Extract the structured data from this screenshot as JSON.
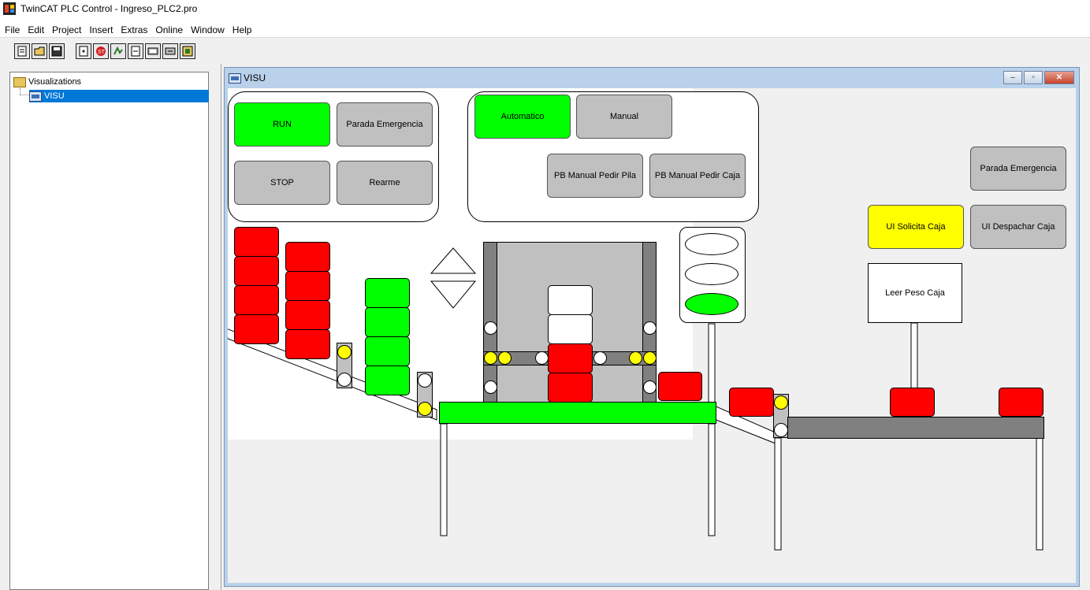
{
  "app": {
    "title": "TwinCAT PLC Control - Ingreso_PLC2.pro"
  },
  "menu": [
    "File",
    "Edit",
    "Project",
    "Insert",
    "Extras",
    "Online",
    "Window",
    "Help"
  ],
  "toolbar_icons": [
    "new-file-icon",
    "open-folder-icon",
    "save-icon",
    "login-icon",
    "stop-icon",
    "run-icon",
    "step-icon",
    "download-icon",
    "upload-icon",
    "monitor-icon"
  ],
  "tree": {
    "root": "Visualizations",
    "child": "VISU"
  },
  "window": {
    "title": "VISU",
    "min": "‒",
    "max": "▫",
    "close": "✕"
  },
  "controls": {
    "run": "RUN",
    "parada_emergencia_1": "Parada Emergencia",
    "stop": "STOP",
    "rearme": "Rearme",
    "automatico": "Automatico",
    "manual": "Manual",
    "pb_pila": "PB Manual Pedir Pila",
    "pb_caja": "PB Manual Pedir Caja",
    "parada_emergencia_2": "Parada Emergencia",
    "ui_solicita_caja": "UI Solicita Caja",
    "ui_despachar_caja": "UI Despachar Caja",
    "leer_peso_caja": "Leer Peso Caja"
  },
  "colors": {
    "active": "#00ff00",
    "inactive": "#c0c0c0",
    "alarm": "#ff0000",
    "warning": "#ffff00",
    "conveyor": "#808080"
  }
}
